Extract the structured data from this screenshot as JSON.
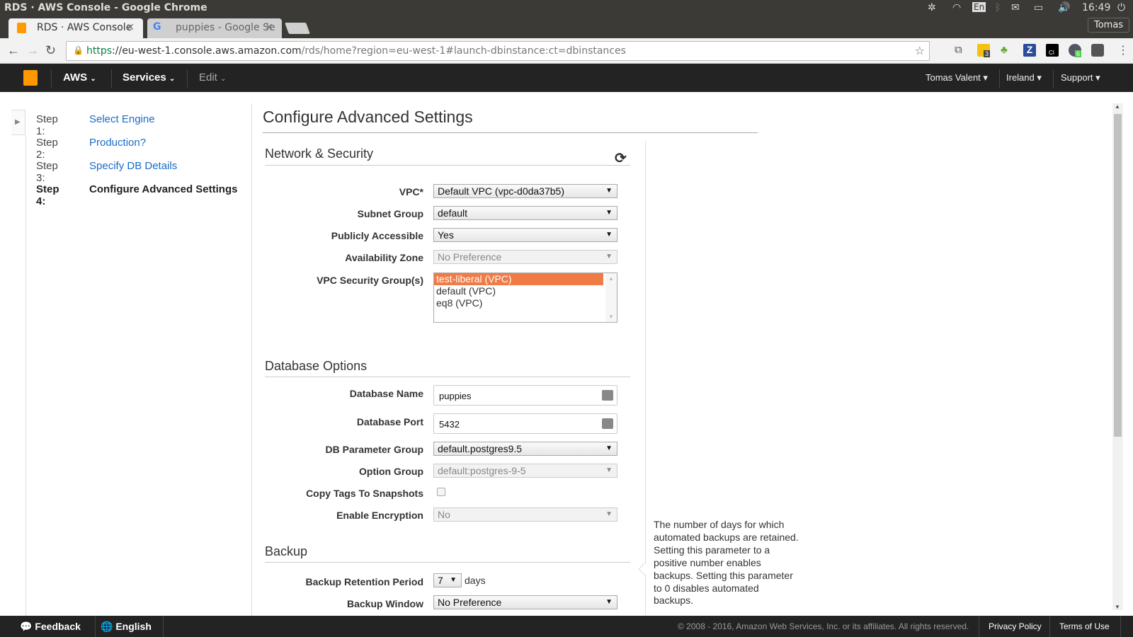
{
  "window": {
    "title": "RDS · AWS Console - Google Chrome",
    "user": "Tomas",
    "clock": "16:49",
    "keyboard": "En"
  },
  "tabs": [
    {
      "label": "RDS · AWS Console",
      "active": true
    },
    {
      "label": "puppies - Google Se",
      "active": false
    }
  ],
  "address": {
    "scheme": "https",
    "host": "://eu-west-1.console.aws.amazon.com",
    "path": "/rds/home?region=eu-west-1#launch-dbinstance:ct=dbinstances"
  },
  "extensions": {
    "badge_1": "3",
    "badge_2": "6",
    "z": "Z",
    "ci": "CI"
  },
  "aws_nav": {
    "aws": "AWS",
    "services": "Services",
    "edit": "Edit",
    "user": "Tomas Valent",
    "region": "Ireland",
    "support": "Support"
  },
  "steps": [
    {
      "num": "Step 1:",
      "label": "Select Engine"
    },
    {
      "num": "Step 2:",
      "label": "Production?"
    },
    {
      "num": "Step 3:",
      "label": "Specify DB Details"
    },
    {
      "num": "Step 4:",
      "label": "Configure Advanced Settings",
      "current": true
    }
  ],
  "page_title": "Configure Advanced Settings",
  "network": {
    "title": "Network & Security",
    "vpc": {
      "label": "VPC*",
      "value": "Default VPC (vpc-d0da37b5)"
    },
    "subnet": {
      "label": "Subnet Group",
      "value": "default"
    },
    "public": {
      "label": "Publicly Accessible",
      "value": "Yes"
    },
    "az": {
      "label": "Availability Zone",
      "value": "No Preference",
      "disabled": true
    },
    "sg": {
      "label": "VPC Security Group(s)",
      "options": [
        "test-liberal (VPC)",
        "default (VPC)",
        "eq8 (VPC)"
      ],
      "selected": "test-liberal (VPC)"
    }
  },
  "db_options": {
    "title": "Database Options",
    "name": {
      "label": "Database Name",
      "value": "puppies"
    },
    "port": {
      "label": "Database Port",
      "value": "5432"
    },
    "param": {
      "label": "DB Parameter Group",
      "value": "default.postgres9.5"
    },
    "option": {
      "label": "Option Group",
      "value": "default:postgres-9-5",
      "disabled": true
    },
    "copy_tags": {
      "label": "Copy Tags To Snapshots",
      "checked": false
    },
    "encryption": {
      "label": "Enable Encryption",
      "value": "No",
      "disabled": true
    }
  },
  "backup": {
    "title": "Backup",
    "retention": {
      "label": "Backup Retention Period",
      "value": "7",
      "unit": "days"
    },
    "window": {
      "label": "Backup Window",
      "value": "No Preference"
    }
  },
  "help_text": "The number of days for which automated backups are retained. Setting this parameter to a positive number enables backups. Setting this parameter to 0 disables automated backups.",
  "footer": {
    "feedback": "Feedback",
    "language": "English",
    "copyright": "© 2008 - 2016, Amazon Web Services, Inc. or its affiliates. All rights reserved.",
    "privacy": "Privacy Policy",
    "terms": "Terms of Use"
  },
  "colors": {
    "accent": "#f07b46",
    "link": "#1a6cc8",
    "nav_bg": "#232323",
    "aws_orange": "#ff9900"
  }
}
